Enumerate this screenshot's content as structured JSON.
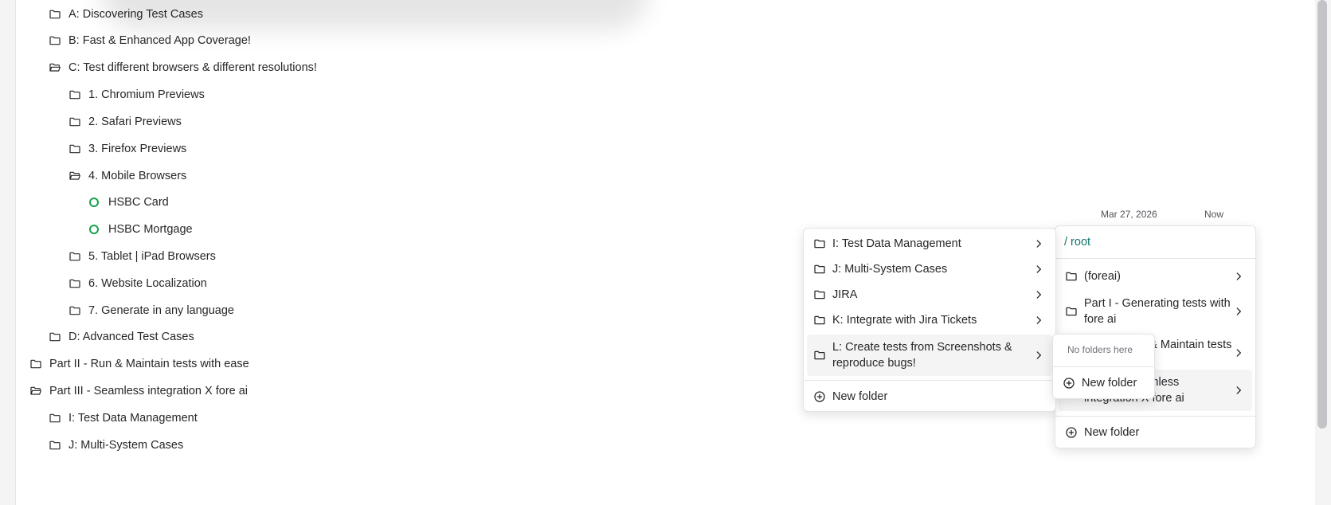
{
  "tree": [
    {
      "label": "A: Discovering Test Cases",
      "icon": "folder-icon"
    },
    {
      "label": "B: Fast & Enhanced App Coverage!",
      "icon": "folder-icon"
    },
    {
      "label": "C: Test different browsers & different resolutions!",
      "icon": "folder-open-icon"
    },
    {
      "label": "1. Chromium Previews",
      "icon": "folder-icon"
    },
    {
      "label": "2. Safari Previews",
      "icon": "folder-icon"
    },
    {
      "label": "3. Firefox Previews",
      "icon": "folder-icon"
    },
    {
      "label": "4. Mobile Browsers",
      "icon": "folder-open-icon"
    },
    {
      "label": "HSBC Card",
      "icon": "status-circle-icon"
    },
    {
      "label": "HSBC Mortgage",
      "icon": "status-circle-icon"
    },
    {
      "label": "5. Tablet | iPad Browsers",
      "icon": "folder-icon"
    },
    {
      "label": "6. Website Localization",
      "icon": "folder-icon"
    },
    {
      "label": "7. Generate in any language",
      "icon": "folder-icon"
    },
    {
      "label": "D: Advanced Test Cases",
      "icon": "folder-icon"
    },
    {
      "label": "Part II - Run & Maintain tests with ease",
      "icon": "folder-icon"
    },
    {
      "label": "Part III - Seamless integration X fore ai",
      "icon": "folder-open-icon"
    },
    {
      "label": "I: Test Data Management",
      "icon": "folder-icon"
    },
    {
      "label": "J: Multi-System Cases",
      "icon": "folder-icon"
    }
  ],
  "columns": {
    "date": "Mar 27, 2026",
    "time": "Now"
  },
  "root_menu": {
    "path": "/ root",
    "items": [
      {
        "label": "(foreai)"
      },
      {
        "label": "Part I - Generating tests with fore ai"
      },
      {
        "label": "Part II - Run & Maintain tests with ease"
      },
      {
        "label": "Part III - Seamless integration X fore ai"
      }
    ],
    "new_folder": "New folder"
  },
  "sub_menu": {
    "items": [
      {
        "label": "I: Test Data Management"
      },
      {
        "label": "J: Multi-System Cases"
      },
      {
        "label": "JIRA"
      },
      {
        "label": "K: Integrate with Jira Tickets"
      },
      {
        "label": "L: Create tests from Screenshots & reproduce bugs!"
      }
    ],
    "new_folder": "New folder"
  },
  "popup": {
    "empty": "No folders here",
    "new_folder": "New folder"
  },
  "colors": {
    "accent": "#0f766e",
    "status": "#16a34a"
  }
}
